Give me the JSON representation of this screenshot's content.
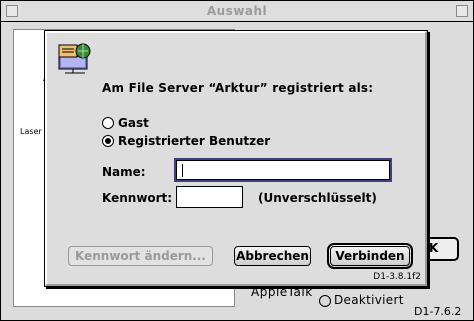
{
  "background_window": {
    "title": "Auswahl",
    "fragment_a": "A",
    "fragment_laser": "Laser",
    "ok_fragment": "K",
    "appletalk_label": "AppleTalk",
    "deactivated_label": "Deaktiviert",
    "version": "D1-7.6.2"
  },
  "dialog": {
    "icon": "file-server-icon",
    "heading": "Am File Server “Arktur” registriert als:",
    "options": [
      {
        "label": "Gast",
        "selected": false
      },
      {
        "label": "Registrierter Benutzer",
        "selected": true
      }
    ],
    "name_label": "Name:",
    "name_value": "",
    "password_label": "Kennwort:",
    "password_value": "",
    "unencrypted_note": "(Unverschlüsselt)",
    "buttons": {
      "change_password": "Kennwort ändern...",
      "cancel": "Abbrechen",
      "connect": "Verbinden"
    },
    "version": "D1-3.8.1f2"
  },
  "colors": {
    "dialog_bg": "#dddddd",
    "focus_ring": "#404080",
    "disabled_text": "#9a9a9a"
  }
}
